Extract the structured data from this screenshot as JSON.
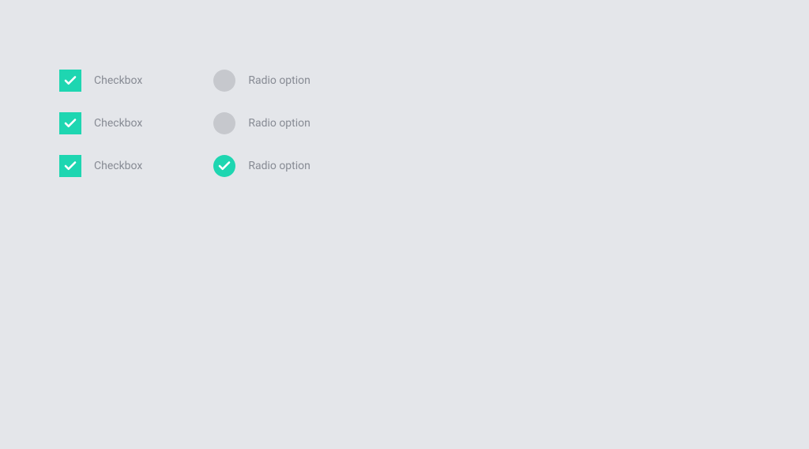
{
  "colors": {
    "accent": "#1ed6b1",
    "inactive": "#c6c8cd",
    "label": "#878b94",
    "background": "#e4e6ea"
  },
  "checkboxes": [
    {
      "label": "Checkbox",
      "checked": true
    },
    {
      "label": "Checkbox",
      "checked": true
    },
    {
      "label": "Checkbox",
      "checked": true
    }
  ],
  "radios": [
    {
      "label": "Radio option",
      "selected": false
    },
    {
      "label": "Radio option",
      "selected": false
    },
    {
      "label": "Radio option",
      "selected": true
    }
  ]
}
